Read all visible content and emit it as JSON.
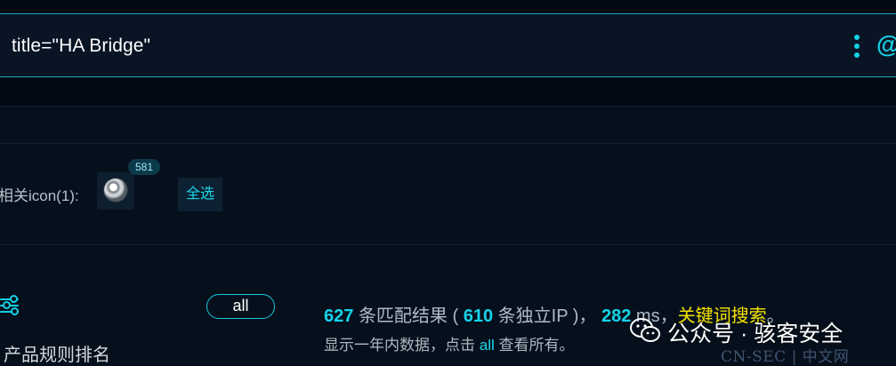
{
  "search": {
    "query": "title=\"HA Bridge\"",
    "more_icon": "more-vertical-icon",
    "at_icon": "at-icon"
  },
  "icons_section": {
    "label": "相关icon(1):",
    "icon_name": "lightbulb-icon",
    "count": "581",
    "select_all_label": "全选"
  },
  "filters": {
    "filter_icon": "sliders-icon",
    "rank_label": "产品规则排名",
    "all_label": "all"
  },
  "results": {
    "match_count": "627",
    "match_text": "条匹配结果 (",
    "ip_count": "610",
    "ip_text": "条独立IP )，",
    "time": "282",
    "time_unit": "ms，",
    "keyword_search": "关键词搜索",
    "period": "。",
    "hint_prefix": "显示一年内数据，点击",
    "hint_all": "all",
    "hint_suffix": "查看所有。"
  },
  "watermark": {
    "icon": "wechat-icon",
    "text": "公众号 · 骇客安全",
    "site": "CN-SEC | 中文网"
  },
  "colors": {
    "background": "#06101c",
    "accent": "#13d1e6",
    "keyword": "#f7e400",
    "border": "#1aa6b7"
  }
}
